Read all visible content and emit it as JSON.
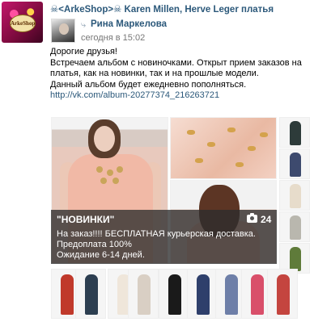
{
  "header": {
    "title": "☠<ArkeShop>☠ Karen Millen, Herve Leger платья",
    "group_logo_text": "ArkeShop"
  },
  "author": {
    "name": "Рина Маркелова",
    "time": "сегодня в 15:02",
    "repost_icon": "repost-icon"
  },
  "post": {
    "lines": [
      "Дорогие друзья!",
      "Встречаем альбом с новиночками. Открыт прием заказов на",
      "платья, как на новинки, так и на прошлые модели.",
      "Данный альбом будет ежедневно пополняться."
    ],
    "link": "http://vk.com/album-20277374_216263721"
  },
  "album": {
    "title": "\"НОВИНКИ\"",
    "count": "24",
    "camera_icon": "camera-icon",
    "description": [
      "На заказ!!!! БЕСПЛАТНАЯ курьерская доставка.",
      "Предоплата 100%",
      "Ожидание 6-14 дней."
    ]
  },
  "colors": {
    "link": "#2b587a",
    "overlay": "#2d2d2d"
  }
}
